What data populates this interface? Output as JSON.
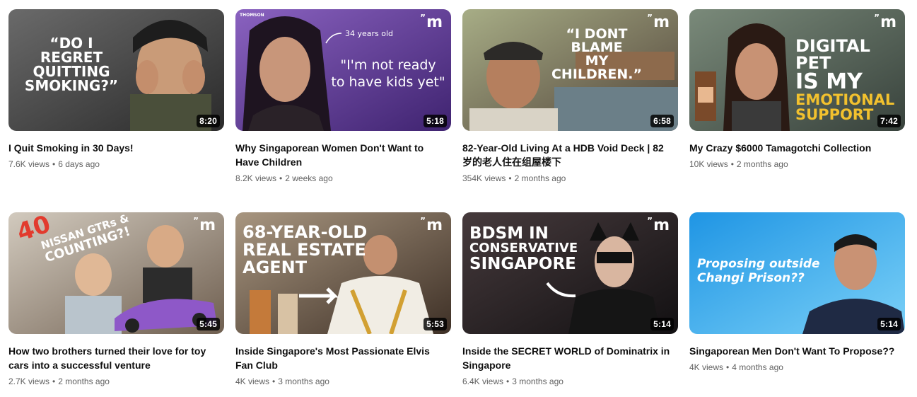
{
  "videos": [
    {
      "title": "I Quit Smoking in 30 Days!",
      "views": "7.6K views",
      "age": "6 days ago",
      "duration": "8:20",
      "overlay_lines": [
        "“DO I REGRET",
        "QUITTING",
        "SMOKING?”"
      ],
      "colors": {
        "bg1": "#5e5e5e",
        "bg2": "#2f2f2f"
      }
    },
    {
      "title": "Why Singaporean Women Don't Want to Have Children",
      "views": "8.2K views",
      "age": "2 weeks ago",
      "duration": "5:18",
      "brand": "THOMSON",
      "caption_small": "34 years old",
      "overlay_lines": [
        "\"I'm not ready",
        "to have kids yet\""
      ],
      "colors": {
        "bg1": "#7b54b0",
        "bg2": "#4b2a7a"
      }
    },
    {
      "title": "82-Year-Old Living At a HDB Void Deck | 82 岁的老人住在组屋楼下",
      "views": "354K views",
      "age": "2 months ago",
      "duration": "6:58",
      "overlay_lines": [
        "“I DONT BLAME",
        "MY CHILDREN.”"
      ],
      "colors": {
        "bg1": "#9aa47a",
        "bg2": "#5c4a3a"
      }
    },
    {
      "title": "My Crazy $6000 Tamagotchi Collection",
      "views": "10K views",
      "age": "2 months ago",
      "duration": "7:42",
      "overlay_lines": [
        "DIGITAL PET",
        "IS MY",
        "EMOTIONAL",
        "SUPPORT"
      ],
      "colors": {
        "bg1": "#6b7a6a",
        "bg2": "#3f4a44",
        "accent": "#f2c12e"
      }
    },
    {
      "title": "How two brothers turned their love for toy cars into a successful venture",
      "views": "2.7K views",
      "age": "2 months ago",
      "duration": "5:45",
      "overlay_lines": [
        "40",
        "NISSAN GTRs &",
        "COUNTING?!"
      ],
      "colors": {
        "bg1": "#c8c0b4",
        "bg2": "#7a6a5a",
        "accent": "#e23b2e"
      }
    },
    {
      "title": "Inside Singapore's Most Passionate Elvis Fan Club",
      "views": "4K views",
      "age": "3 months ago",
      "duration": "5:53",
      "overlay_lines": [
        "68-YEAR-OLD",
        "REAL ESTATE",
        "AGENT"
      ],
      "colors": {
        "bg1": "#9c8a74",
        "bg2": "#4b3a2c"
      }
    },
    {
      "title": "Inside the SECRET WORLD of Dominatrix in Singapore",
      "views": "6.4K views",
      "age": "3 months ago",
      "duration": "5:14",
      "overlay_lines": [
        "BDSM IN",
        "CONSERVATIVE",
        "SINGAPORE"
      ],
      "colors": {
        "bg1": "#3a3032",
        "bg2": "#161214"
      }
    },
    {
      "title": "Singaporean Men Don't Want To Propose??",
      "views": "4K views",
      "age": "4 months ago",
      "duration": "5:14",
      "overlay_lines": [
        "Proposing outside",
        "Changi Prison??"
      ],
      "colors": {
        "bg1": "#2a9fe8",
        "bg2": "#6cc8f5"
      }
    }
  ],
  "brand_logo": "m"
}
